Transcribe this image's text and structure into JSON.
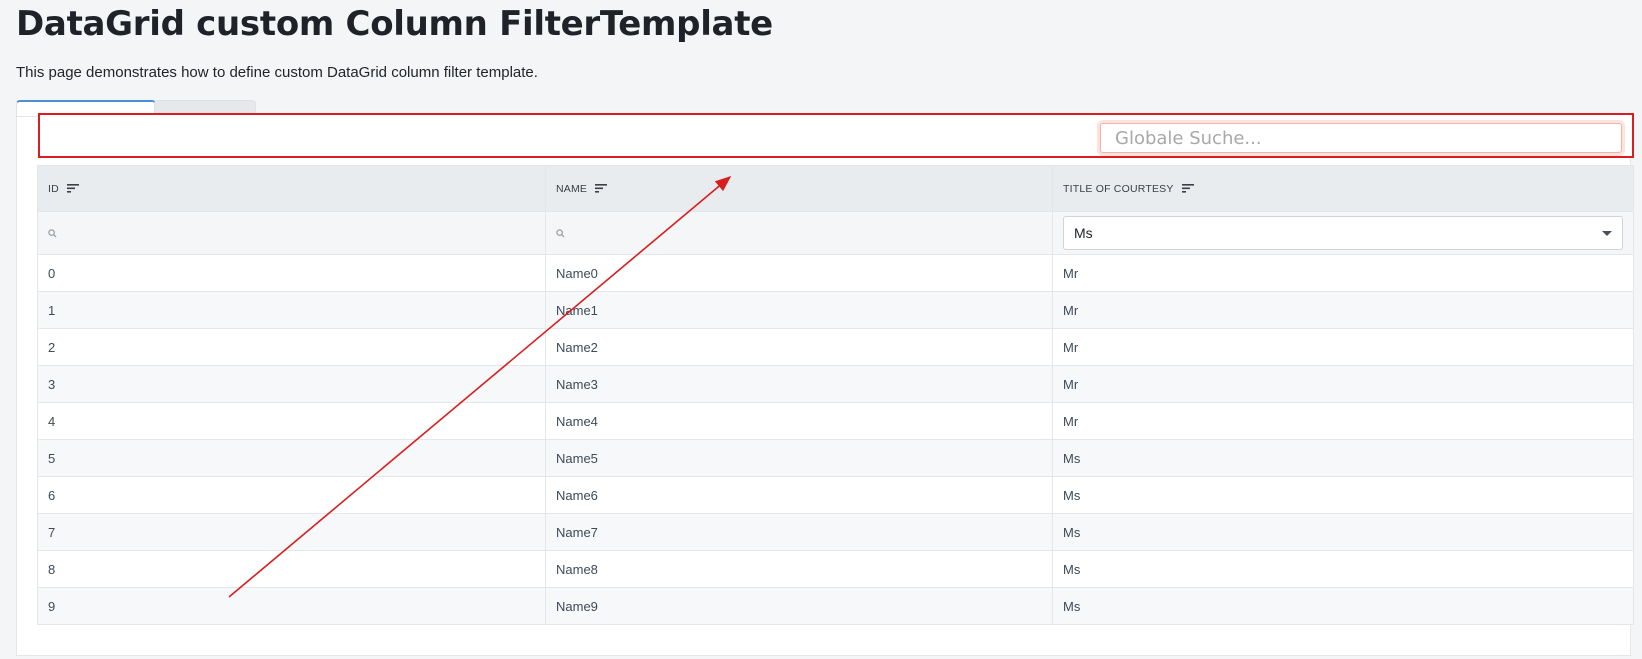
{
  "page": {
    "title": "DataGrid custom Column FilterTemplate",
    "description": "This page demonstrates how to define custom DataGrid column filter template."
  },
  "toolbar": {
    "global_search_placeholder": "Globale Suche..."
  },
  "grid": {
    "columns": [
      {
        "label": "ID"
      },
      {
        "label": "NAME"
      },
      {
        "label": "TITLE OF COURTESY"
      }
    ],
    "filters": {
      "title_selected": "Ms"
    },
    "rows": [
      {
        "id": "0",
        "name": "Name0",
        "title": "Mr"
      },
      {
        "id": "1",
        "name": "Name1",
        "title": "Mr"
      },
      {
        "id": "2",
        "name": "Name2",
        "title": "Mr"
      },
      {
        "id": "3",
        "name": "Name3",
        "title": "Mr"
      },
      {
        "id": "4",
        "name": "Name4",
        "title": "Mr"
      },
      {
        "id": "5",
        "name": "Name5",
        "title": "Ms"
      },
      {
        "id": "6",
        "name": "Name6",
        "title": "Ms"
      },
      {
        "id": "7",
        "name": "Name7",
        "title": "Ms"
      },
      {
        "id": "8",
        "name": "Name8",
        "title": "Ms"
      },
      {
        "id": "9",
        "name": "Name9",
        "title": "Ms"
      }
    ]
  },
  "colors": {
    "annotation_red": "#d81e1e",
    "tab_accent": "#4a8fd3"
  },
  "icons": [
    "sort-icon",
    "search-icon",
    "chevron-down-icon"
  ]
}
